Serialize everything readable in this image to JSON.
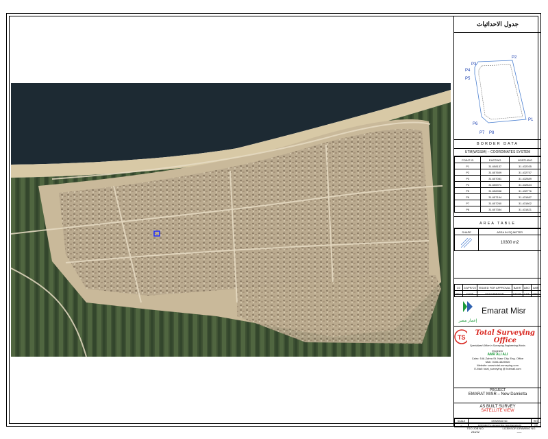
{
  "coord_table": {
    "title": "جدول الاحداثيات",
    "points": [
      "P1",
      "P2",
      "P3",
      "P4",
      "P5",
      "P6",
      "P7",
      "P8"
    ],
    "border_header": "BORDER DATA",
    "system": "UTM(WGS84) – COORDINATES SYSTEM",
    "columns": [
      "POINT ID",
      "EASTING",
      "NORTHING"
    ],
    "rows": [
      [
        "P1",
        "31.658137",
        "31.432035"
      ],
      [
        "P2",
        "31.657609",
        "31.432757"
      ],
      [
        "P3",
        "31.657081",
        "31.432889"
      ],
      [
        "P4",
        "31.656971",
        "31.432844"
      ],
      [
        "P5",
        "31.656958",
        "31.432776"
      ],
      [
        "P6",
        "31.657194",
        "31.431887"
      ],
      [
        "P7",
        "31.657260",
        "31.431802"
      ],
      [
        "P8",
        "31.657384",
        "31.431821"
      ]
    ]
  },
  "area_table": {
    "header": "AREA TABLE",
    "columns": [
      "SHAPE",
      "AREA IN SQ.METER"
    ],
    "value": "10300 m2"
  },
  "revision": {
    "row": [
      "C0",
      "2/APR/'22",
      "ISSUED FOR APPROVAL",
      "BAKR",
      "ABO",
      "AMR"
    ],
    "labels": [
      "REV",
      "DATE",
      "DESCRIPTION",
      "DRWN",
      "CHK",
      "APPR"
    ]
  },
  "client": {
    "name": "Emarat Misr",
    "logo_text": "إعمار مصر"
  },
  "office": {
    "name": "Total Surveying Office",
    "tagline": "Specialized Office in Surveying Engineering Works",
    "engineer_label": "Engineer",
    "engineer": "AMR ALI ALI",
    "address": "Cairo: 5 Al-Zahra St. Nasr City, Eng. Office",
    "mobile": "Mob: 0106-4325920",
    "website": "Website: www.total-surveying.com",
    "email": "E-Mail: total_surveying @ hotmail.com"
  },
  "project": {
    "label": "PROJECT",
    "name": "EMARAT MISR – New Damietta"
  },
  "drawing": {
    "title": "AS BUILT SURVEY",
    "subtitle": "SATELLITE VIEW"
  },
  "footer": {
    "scale_label": "SCALE",
    "scale": "–",
    "drawing_no_label": "DRAWING NO.",
    "drawing_no": "3-PROJECTS-1-Emarat Misr–New Damietta-01",
    "rev_label": "REV",
    "rev": "C0",
    "tso_job_label": "TSO JOB NO.",
    "tso_job": "244/22",
    "licensor_label": "LICENSOR DRAWING NO.",
    "licensor": "–––"
  },
  "colors": {
    "accent_red": "#d8261f",
    "accent_green": "#1c9a3a",
    "sat_red_text": "#d8261f"
  }
}
